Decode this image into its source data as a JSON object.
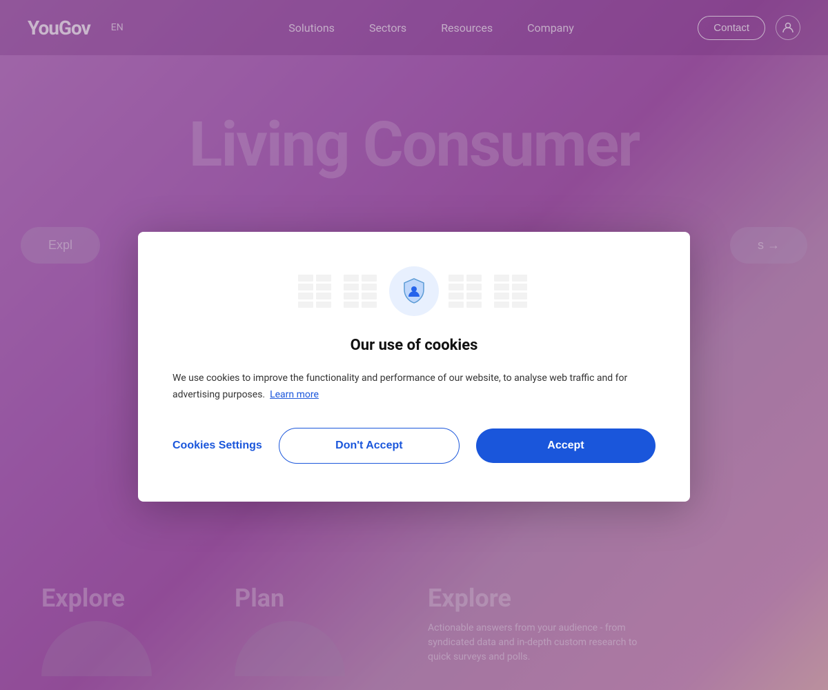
{
  "navbar": {
    "logo": "YouGov",
    "lang": "EN",
    "nav_links": [
      {
        "label": "Solutions",
        "id": "solutions"
      },
      {
        "label": "Sectors",
        "id": "sectors"
      },
      {
        "label": "Resources",
        "id": "resources"
      },
      {
        "label": "Company",
        "id": "company"
      }
    ],
    "contact_label": "Contact"
  },
  "hero": {
    "title": "Living Consumer",
    "explore_left": "Expl",
    "explore_right": "s →"
  },
  "bottom": {
    "cols": [
      {
        "heading": "Explore",
        "desc": ""
      },
      {
        "heading": "Plan",
        "desc": ""
      },
      {
        "heading": "Explore",
        "desc": "Actionable answers from your audience - from syndicated data and in-depth custom research to quick surveys and polls."
      }
    ]
  },
  "cookie_modal": {
    "title": "Our use of cookies",
    "description": "We use cookies to improve the functionality and performance of our website, to analyse web traffic and for advertising purposes.",
    "learn_more": "Learn more",
    "btn_settings": "Cookies Settings",
    "btn_dont_accept": "Don't Accept",
    "btn_accept": "Accept"
  }
}
